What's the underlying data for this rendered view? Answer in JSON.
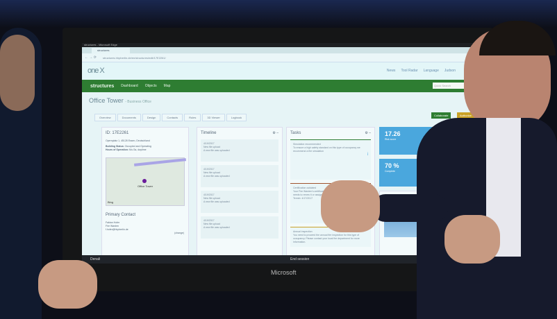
{
  "window": {
    "title": "structures - Microsoft Edge",
    "tab": "structures",
    "url": "structures.hhpberlin.de/en/structures/edit/17E2261/"
  },
  "header": {
    "logo": "one X",
    "links": [
      "News",
      "Tool Radar",
      "Language",
      "Judson"
    ]
  },
  "nav": {
    "brand": "structures",
    "items": [
      "Dashboard",
      "Objects",
      "Map"
    ],
    "search_placeholder": "Quick Search"
  },
  "page": {
    "title": "Office Tower",
    "subtitle": "- Business Office",
    "buttons": [
      "Collaborate",
      "Authorize"
    ],
    "tabs": [
      "Overview",
      "Documents",
      "Design",
      "Contacts",
      "Rules",
      "3D Viewer",
      "Logbook"
    ]
  },
  "info": {
    "id": "ID: 17E2261",
    "address": "Opernplatz 1, 45128 Essen, Deutschland",
    "status_label": "Building Status:",
    "status": "Occupied and Operating",
    "hours_label": "Hours of Operation:",
    "hours": "Mo-Sa, daytime",
    "map_label": "Office Tower",
    "map_provider": "Bing",
    "contact_title": "Primary Contact",
    "contact_change": "(change)",
    "contact": [
      "Fabian Hofer",
      "Fire Warden",
      "f.hofer@hhpberlin.de"
    ]
  },
  "timeline": {
    "title": "Timeline",
    "items": [
      {
        "date": "4/19/2017",
        "title": "New file upload",
        "text": "A new file was uploaded"
      },
      {
        "date": "4/19/2017",
        "title": "New file upload",
        "text": "A new file was uploaded"
      },
      {
        "date": "4/19/2017",
        "title": "New file upload",
        "text": "A new file was uploaded"
      },
      {
        "date": "4/19/2017",
        "title": "New file upload",
        "text": "A new file was uploaded"
      }
    ]
  },
  "tasks": {
    "title": "Tasks",
    "items": [
      {
        "title": "Simulation recommended",
        "text": "To ensure a high safety standard on this type of occupancy we recommend a fire simulation"
      },
      {
        "title": "Certification outdated",
        "text": "Your Fire Warden's certificate is not valid any more. The person needs to renew it or assign another.",
        "due": "Termin: 4/17/2017"
      },
      {
        "title": "Annual inspection",
        "text": "You need to proceed the annual fire inspection for this type of occupancy. Please contact your local fire department for more information."
      }
    ]
  },
  "stats": [
    {
      "value": "17.26",
      "label": "Risk score"
    },
    {
      "value": "70 %",
      "label": "Complete"
    }
  ],
  "taskbar": {
    "left": "Denali",
    "right": "End session"
  },
  "monitor_brand": "Microsoft"
}
